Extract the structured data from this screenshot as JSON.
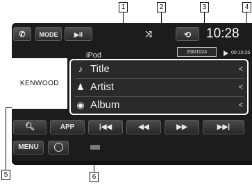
{
  "top_bar": {
    "mode_label": "MODE",
    "play_pause_label": "▶II",
    "shuffle_icon": "shuffle-icon",
    "repeat_icon": "repeat-icon",
    "clock": "10:28"
  },
  "status": {
    "source": "iPod",
    "track_counter": "256/1024",
    "elapsed_time": "00:10:25"
  },
  "artwork": {
    "label": "KENWOOD"
  },
  "info": {
    "rows": [
      {
        "icon": "music-note-icon",
        "label": "Title"
      },
      {
        "icon": "person-icon",
        "label": "Artist"
      },
      {
        "icon": "disc-icon",
        "label": "Album"
      }
    ]
  },
  "controls": {
    "search_icon": "search-icon",
    "app_label": "APP",
    "prev_icon": "skip-back-icon",
    "rewind_icon": "rewind-icon",
    "forward_icon": "fast-forward-icon",
    "next_icon": "skip-forward-icon"
  },
  "bottom": {
    "menu_label": "MENU"
  },
  "callouts": [
    "1",
    "2",
    "3",
    "4",
    "5",
    "6"
  ]
}
